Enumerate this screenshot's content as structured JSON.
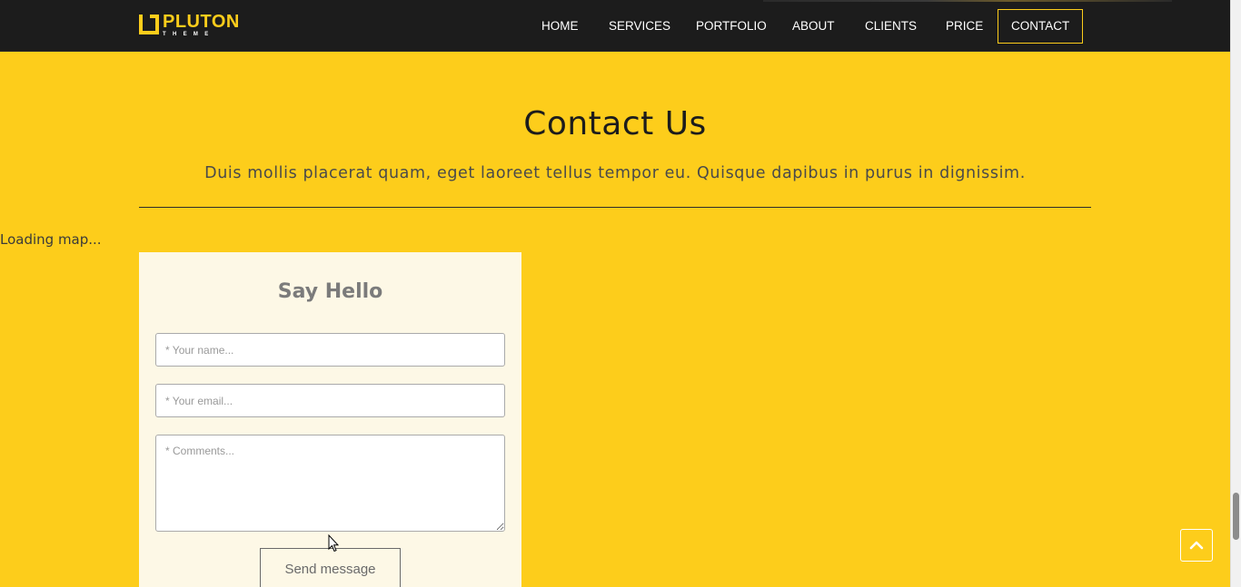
{
  "brand": {
    "name": "PLUTON",
    "tagline": "THEME",
    "accent_color": "#fdcd1b",
    "nav_bg": "#1c1c1c"
  },
  "nav": {
    "items": [
      {
        "label": "HOME",
        "active": false
      },
      {
        "label": "SERVICES",
        "active": false
      },
      {
        "label": "PORTFOLIO",
        "active": false
      },
      {
        "label": "ABOUT",
        "active": false
      },
      {
        "label": "CLIENTS",
        "active": false
      },
      {
        "label": "PRICE",
        "active": false
      },
      {
        "label": "CONTACT",
        "active": true
      }
    ]
  },
  "contact": {
    "title": "Contact Us",
    "subtitle": "Duis mollis placerat quam, eget laoreet tellus tempor eu. Quisque dapibus in purus in dignissim.",
    "map_status": "Loading map..."
  },
  "form": {
    "title": "Say Hello",
    "name_placeholder": "* Your name...",
    "email_placeholder": "* Your email...",
    "comments_placeholder": "* Comments...",
    "send_label": "Send message"
  },
  "icons": {
    "back_to_top": "chevron-up-icon",
    "logo": "pluton-logo-icon"
  }
}
